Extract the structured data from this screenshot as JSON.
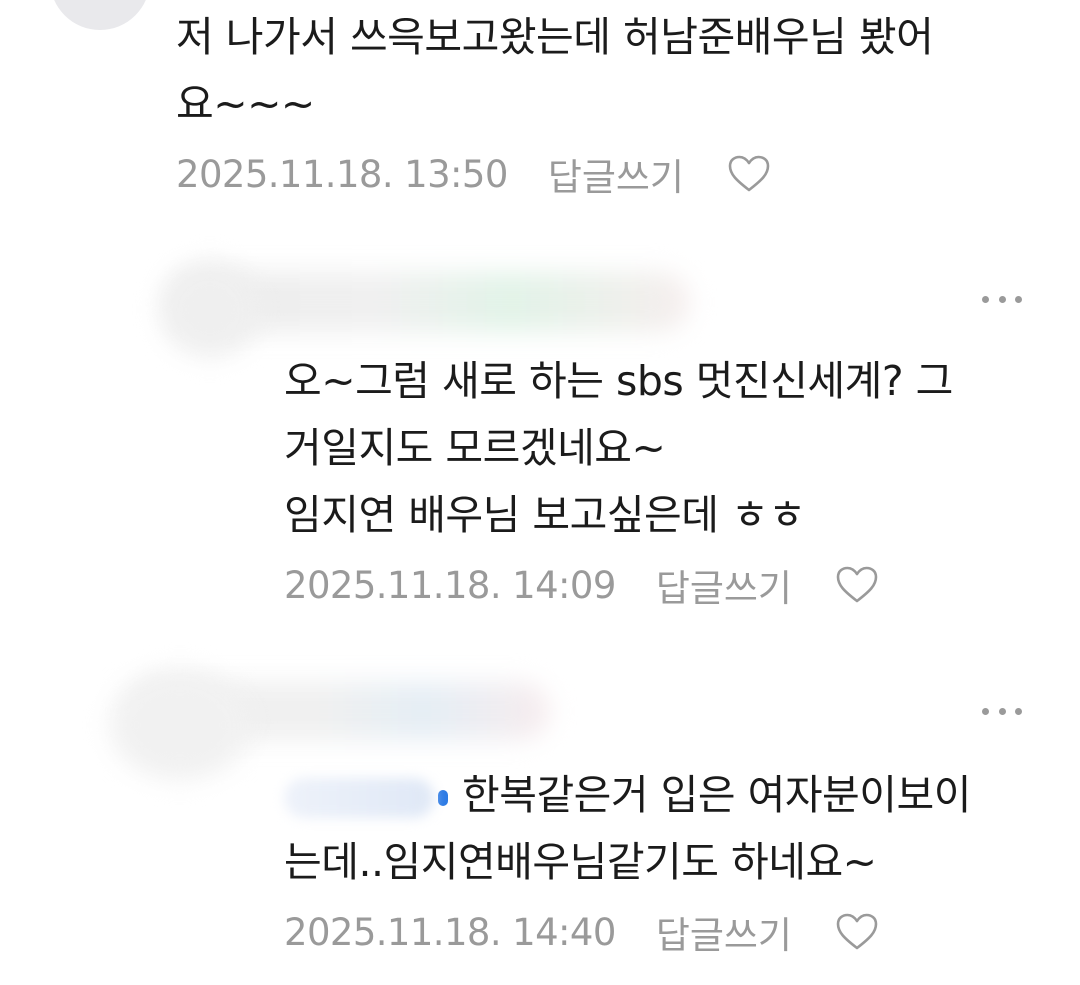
{
  "comments": [
    {
      "text_lines": [
        "저 나가서 쓰윽보고왔는데 허남준배우님 봤어",
        "요~~~"
      ],
      "date": "2025.11.18. 13:50",
      "reply_label": "답글쓰기",
      "like_icon": "heart-outline-icon"
    },
    {
      "text_lines": [
        "오~그럼 새로 하는 sbs 멋진신세계? 그",
        "거일지도 모르겠네요~",
        "임지연 배우님 보고싶은데 ㅎㅎ"
      ],
      "date": "2025.11.18. 14:09",
      "reply_label": "답글쓰기",
      "like_icon": "heart-outline-icon",
      "more_icon": "more-dots-icon"
    },
    {
      "text_lines": [
        "한복같은거 입은 여자분이보이",
        "는데..임지연배우님같기도 하네요~"
      ],
      "date": "2025.11.18. 14:40",
      "reply_label": "답글쓰기",
      "like_icon": "heart-outline-icon",
      "more_icon": "more-dots-icon"
    }
  ],
  "colors": {
    "text": "#1b1b1b",
    "meta": "#9a9a9a",
    "background": "#ffffff"
  }
}
